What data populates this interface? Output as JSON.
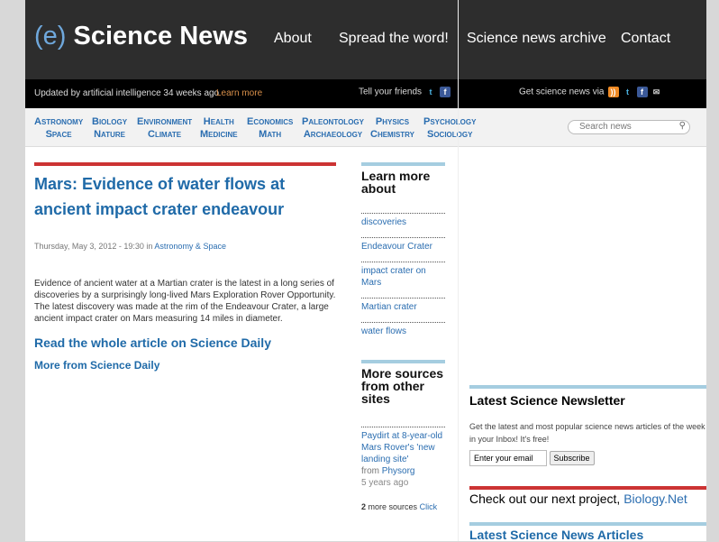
{
  "header": {
    "logo_prefix": "(e)",
    "logo_text": "Science News",
    "nav": [
      "About",
      "Spread the word!",
      "Science news archive",
      "Contact"
    ]
  },
  "infobar": {
    "updated": "Updated by artificial intelligence 34 weeks ago",
    "learn_more": "Learn more",
    "tell": "Tell your friends",
    "get": "Get science news via"
  },
  "categories": [
    [
      "Astronomy",
      "Space"
    ],
    [
      "Biology",
      "Nature"
    ],
    [
      "Environment",
      "Climate"
    ],
    [
      "Health",
      "Medicine"
    ],
    [
      "Economics",
      "Math"
    ],
    [
      "Paleontology",
      "Archaeology"
    ],
    [
      "Physics",
      "Chemistry"
    ],
    [
      "Psychology",
      "Sociology"
    ]
  ],
  "search": {
    "placeholder": "Search news"
  },
  "article": {
    "title": "Mars: Evidence of water flows at ancient impact crater endeavour",
    "date": "Thursday, May 3, 2012 - 19:30 in",
    "category": "Astronomy & Space",
    "body": "Evidence of ancient water at a Martian crater is the latest in a long series of discoveries by a surprisingly long-lived Mars Exploration Rover Opportunity. The latest discovery was made at the rim of the Endeavour Crater, a large ancient impact crater on Mars measuring 14 miles in diameter.",
    "read": "Read the whole article on Science Daily",
    "more": "More from Science Daily"
  },
  "learn": {
    "title": "Learn more about",
    "links": [
      "discoveries",
      "Endeavour Crater",
      "impact crater on Mars",
      "Martian crater",
      "water flows"
    ]
  },
  "sources": {
    "title": "More sources from other sites",
    "item": "Paydirt at 8-year-old Mars Rover's 'new landing site'",
    "from": "from",
    "source": "Physorg",
    "age": "5 years ago",
    "count": "2",
    "more": "more sources",
    "click": "Click"
  },
  "newsletter": {
    "title": "Latest Science Newsletter",
    "text": "Get the latest and most popular science news articles of the week in your Inbox! It's free!",
    "placeholder": "Enter your email",
    "button": "Subscribe"
  },
  "project": {
    "text": "Check out our next project,",
    "link": "Biology.Net"
  },
  "latest": {
    "title": "Latest Science News Articles"
  }
}
